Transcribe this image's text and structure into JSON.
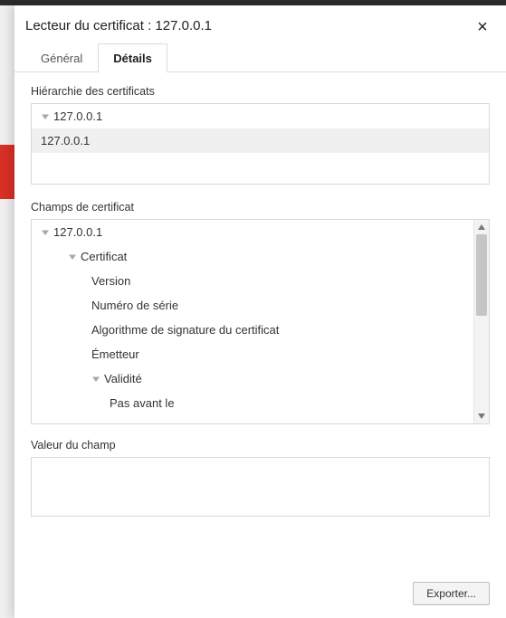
{
  "dialog": {
    "title": "Lecteur du certificat : 127.0.0.1",
    "close_glyph": "×"
  },
  "tabs": {
    "general": "Général",
    "details": "Détails"
  },
  "hierarchy": {
    "label": "Hiérarchie des certificats",
    "root": "127.0.0.1",
    "child": "127.0.0.1"
  },
  "fields": {
    "label": "Champs de certificat",
    "root": "127.0.0.1",
    "certificat": "Certificat",
    "version": "Version",
    "serial": "Numéro de série",
    "sig_alg": "Algorithme de signature du certificat",
    "issuer": "Émetteur",
    "validity": "Validité",
    "not_before": "Pas avant le"
  },
  "value": {
    "label": "Valeur du champ"
  },
  "footer": {
    "export": "Exporter..."
  }
}
